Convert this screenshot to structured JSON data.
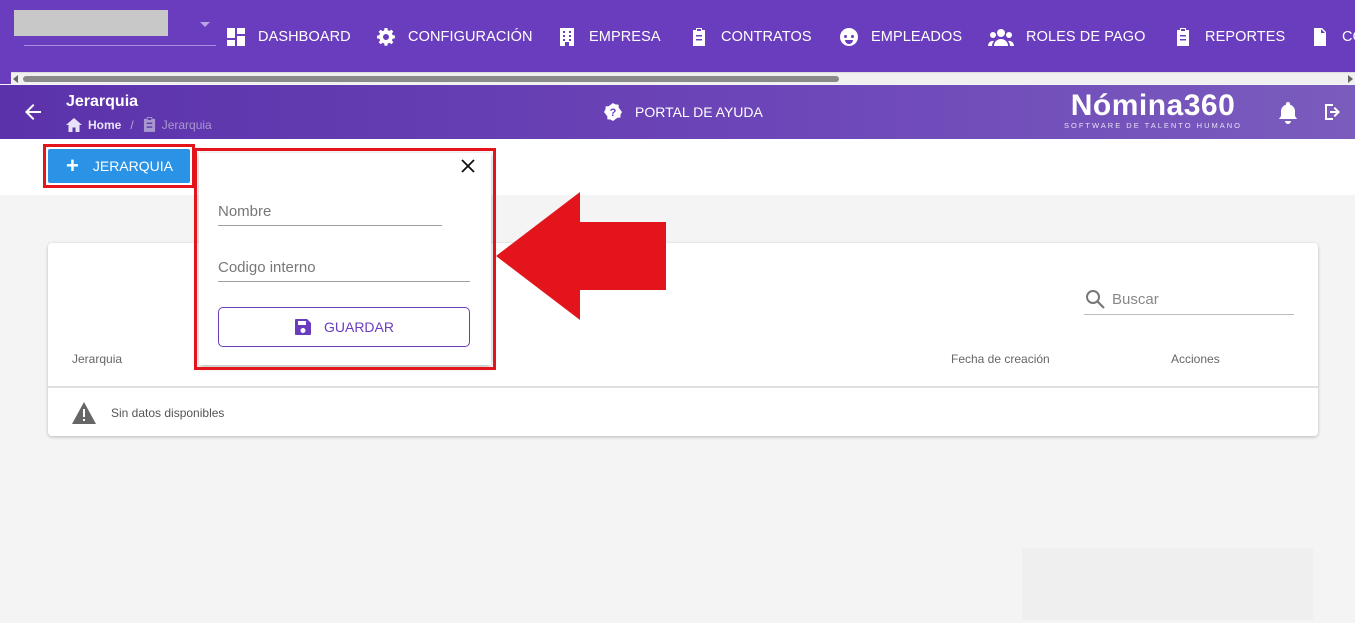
{
  "nav": {
    "items": [
      {
        "label": "DASHBOARD",
        "icon": "dashboard-icon"
      },
      {
        "label": "CONFIGURACIÓN",
        "icon": "gear-icon"
      },
      {
        "label": "EMPRESA",
        "icon": "building-icon"
      },
      {
        "label": "CONTRATOS",
        "icon": "clipboard-icon"
      },
      {
        "label": "EMPLEADOS",
        "icon": "face-icon"
      },
      {
        "label": "ROLES DE PAGO",
        "icon": "users-icon"
      },
      {
        "label": "REPORTES",
        "icon": "clipboard-list-icon"
      },
      {
        "label": "CO",
        "icon": "invoice-icon"
      }
    ]
  },
  "header": {
    "title": "Jerarquia",
    "breadcrumb": {
      "home": "Home",
      "separator": "/",
      "current": "Jerarquia"
    },
    "help_label": "PORTAL DE AYUDA",
    "brand_name": "Nómina360",
    "brand_tagline": "SOFTWARE DE TALENTO HUMANO"
  },
  "toolbar": {
    "add_label": "JERARQUIA"
  },
  "popup": {
    "name_placeholder": "Nombre",
    "code_placeholder": "Codigo interno",
    "save_label": "GUARDAR"
  },
  "table": {
    "search_placeholder": "Buscar",
    "columns": [
      "Jerarquia",
      "Fecha de creación",
      "Acciones"
    ],
    "empty_message": "Sin datos disponibles"
  },
  "colors": {
    "primary": "#6a3dbe",
    "button_blue": "#2a93e6",
    "highlight_red": "#e3141c"
  }
}
